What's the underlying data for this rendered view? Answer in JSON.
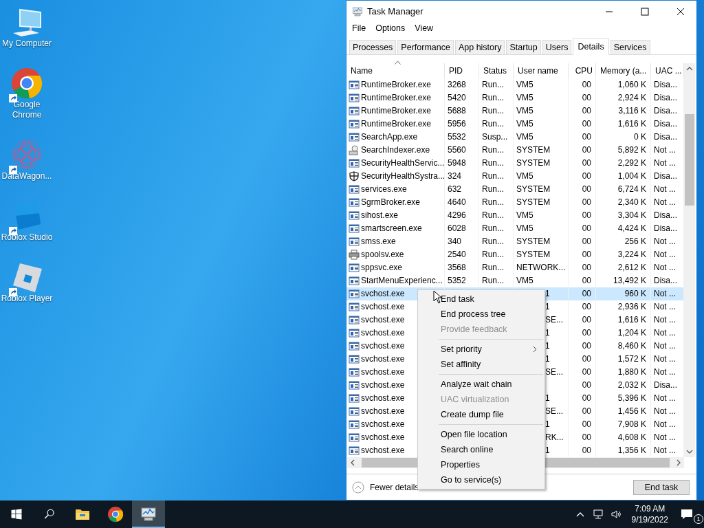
{
  "desktop": {
    "icons": [
      {
        "label": "My Computer",
        "kind": "computer",
        "shortcut": false
      },
      {
        "label": "Google Chrome",
        "kind": "chrome",
        "shortcut": true
      },
      {
        "label": "DataWagon...",
        "kind": "datawagon",
        "shortcut": true
      },
      {
        "label": "Roblox Studio",
        "kind": "studio",
        "shortcut": true
      },
      {
        "label": "Roblox Player",
        "kind": "player",
        "shortcut": true
      }
    ]
  },
  "window": {
    "title": "Task Manager",
    "menu": [
      "File",
      "Options",
      "View"
    ],
    "tabs": [
      {
        "label": "Processes",
        "selected": false
      },
      {
        "label": "Performance",
        "selected": false
      },
      {
        "label": "App history",
        "selected": false
      },
      {
        "label": "Startup",
        "selected": false
      },
      {
        "label": "Users",
        "selected": false
      },
      {
        "label": "Details",
        "selected": true
      },
      {
        "label": "Services",
        "selected": false
      }
    ],
    "table": {
      "columns": [
        "Name",
        "PID",
        "Status",
        "User name",
        "CPU",
        "Memory (a...",
        "UAC ..."
      ],
      "rows": [
        {
          "kind": "app",
          "name": "RuntimeBroker.exe",
          "pid": "3268",
          "status": "Run...",
          "user": "VM5",
          "cpu": "00",
          "memory": "1,060 K",
          "uac": "Disa...",
          "selected": false
        },
        {
          "kind": "app",
          "name": "RuntimeBroker.exe",
          "pid": "5420",
          "status": "Run...",
          "user": "VM5",
          "cpu": "00",
          "memory": "2,924 K",
          "uac": "Disa...",
          "selected": false
        },
        {
          "kind": "app",
          "name": "RuntimeBroker.exe",
          "pid": "5688",
          "status": "Run...",
          "user": "VM5",
          "cpu": "00",
          "memory": "3,116 K",
          "uac": "Disa...",
          "selected": false
        },
        {
          "kind": "app",
          "name": "RuntimeBroker.exe",
          "pid": "5956",
          "status": "Run...",
          "user": "VM5",
          "cpu": "00",
          "memory": "1,616 K",
          "uac": "Disa...",
          "selected": false
        },
        {
          "kind": "app",
          "name": "SearchApp.exe",
          "pid": "5532",
          "status": "Susp...",
          "user": "VM5",
          "cpu": "00",
          "memory": "0 K",
          "uac": "Disa...",
          "selected": false
        },
        {
          "kind": "indexer",
          "name": "SearchIndexer.exe",
          "pid": "5560",
          "status": "Run...",
          "user": "SYSTEM",
          "cpu": "00",
          "memory": "5,892 K",
          "uac": "Not ...",
          "selected": false
        },
        {
          "kind": "app",
          "name": "SecurityHealthServic...",
          "pid": "5948",
          "status": "Run...",
          "user": "SYSTEM",
          "cpu": "00",
          "memory": "2,292 K",
          "uac": "Not ...",
          "selected": false
        },
        {
          "kind": "shield",
          "name": "SecurityHealthSystra...",
          "pid": "324",
          "status": "Run...",
          "user": "VM5",
          "cpu": "00",
          "memory": "1,004 K",
          "uac": "Disa...",
          "selected": false
        },
        {
          "kind": "app",
          "name": "services.exe",
          "pid": "632",
          "status": "Run...",
          "user": "SYSTEM",
          "cpu": "00",
          "memory": "6,724 K",
          "uac": "Not ...",
          "selected": false
        },
        {
          "kind": "app",
          "name": "SgrmBroker.exe",
          "pid": "4640",
          "status": "Run...",
          "user": "SYSTEM",
          "cpu": "00",
          "memory": "2,340 K",
          "uac": "Not ...",
          "selected": false
        },
        {
          "kind": "app",
          "name": "sihost.exe",
          "pid": "4296",
          "status": "Run...",
          "user": "VM5",
          "cpu": "00",
          "memory": "3,304 K",
          "uac": "Disa...",
          "selected": false
        },
        {
          "kind": "app",
          "name": "smartscreen.exe",
          "pid": "6028",
          "status": "Run...",
          "user": "VM5",
          "cpu": "00",
          "memory": "4,424 K",
          "uac": "Disa...",
          "selected": false
        },
        {
          "kind": "app",
          "name": "smss.exe",
          "pid": "340",
          "status": "Run...",
          "user": "SYSTEM",
          "cpu": "00",
          "memory": "256 K",
          "uac": "Not ...",
          "selected": false
        },
        {
          "kind": "printer",
          "name": "spoolsv.exe",
          "pid": "2540",
          "status": "Run...",
          "user": "SYSTEM",
          "cpu": "00",
          "memory": "3,224 K",
          "uac": "Not ...",
          "selected": false
        },
        {
          "kind": "app",
          "name": "sppsvc.exe",
          "pid": "3568",
          "status": "Run...",
          "user": "NETWORK...",
          "cpu": "00",
          "memory": "2,612 K",
          "uac": "Not ...",
          "selected": false
        },
        {
          "kind": "app",
          "name": "StartMenuExperienc...",
          "pid": "5352",
          "status": "Run...",
          "user": "VM5",
          "cpu": "00",
          "memory": "13,492 K",
          "uac": "Disa...",
          "selected": false
        },
        {
          "kind": "app",
          "name": "svchost.exe",
          "user": "1",
          "cpu": "00",
          "memory": "960 K",
          "uac": "Not ...",
          "selected": true
        },
        {
          "kind": "app",
          "name": "svchost.exe",
          "user": "1",
          "cpu": "00",
          "memory": "2,936 K",
          "uac": "Not ...",
          "selected": false
        },
        {
          "kind": "app",
          "name": "svchost.exe",
          "user": "SE...",
          "cpu": "00",
          "memory": "1,616 K",
          "uac": "Not ...",
          "selected": false
        },
        {
          "kind": "app",
          "name": "svchost.exe",
          "user": "1",
          "cpu": "00",
          "memory": "1,204 K",
          "uac": "Not ...",
          "selected": false
        },
        {
          "kind": "app",
          "name": "svchost.exe",
          "user": "1",
          "cpu": "00",
          "memory": "8,460 K",
          "uac": "Not ...",
          "selected": false
        },
        {
          "kind": "app",
          "name": "svchost.exe",
          "user": "1",
          "cpu": "00",
          "memory": "1,572 K",
          "uac": "Not ...",
          "selected": false
        },
        {
          "kind": "app",
          "name": "svchost.exe",
          "user": "SE...",
          "cpu": "00",
          "memory": "1,880 K",
          "uac": "Not ...",
          "selected": false
        },
        {
          "kind": "app",
          "name": "svchost.exe",
          "cpu": "00",
          "memory": "2,032 K",
          "uac": "Disa...",
          "selected": false
        },
        {
          "kind": "app",
          "name": "svchost.exe",
          "user": "1",
          "cpu": "00",
          "memory": "5,396 K",
          "uac": "Not ...",
          "selected": false
        },
        {
          "kind": "app",
          "name": "svchost.exe",
          "user": "SE...",
          "cpu": "00",
          "memory": "1,456 K",
          "uac": "Not ...",
          "selected": false
        },
        {
          "kind": "app",
          "name": "svchost.exe",
          "user": "1",
          "cpu": "00",
          "memory": "7,908 K",
          "uac": "Not ...",
          "selected": false
        },
        {
          "kind": "app",
          "name": "svchost.exe",
          "user": "RK...",
          "cpu": "00",
          "memory": "4,608 K",
          "uac": "Not ...",
          "selected": false
        },
        {
          "kind": "app",
          "name": "svchost.exe",
          "user": "1",
          "cpu": "00",
          "memory": "1,356 K",
          "uac": "Not ...",
          "selected": false
        }
      ]
    },
    "footer": {
      "toggle": "Fewer details",
      "button": "End task"
    },
    "context_menu": {
      "groups": [
        [
          {
            "label": "End task",
            "disabled": false,
            "submenu": false
          },
          {
            "label": "End process tree",
            "disabled": false,
            "submenu": false
          },
          {
            "label": "Provide feedback",
            "disabled": true,
            "submenu": false
          }
        ],
        [
          {
            "label": "Set priority",
            "disabled": false,
            "submenu": true
          },
          {
            "label": "Set affinity",
            "disabled": false,
            "submenu": false
          }
        ],
        [
          {
            "label": "Analyze wait chain",
            "disabled": false,
            "submenu": false
          },
          {
            "label": "UAC virtualization",
            "disabled": true,
            "submenu": false
          },
          {
            "label": "Create dump file",
            "disabled": false,
            "submenu": false
          }
        ],
        [
          {
            "label": "Open file location",
            "disabled": false,
            "submenu": false
          },
          {
            "label": "Search online",
            "disabled": false,
            "submenu": false
          },
          {
            "label": "Properties",
            "disabled": false,
            "submenu": false
          },
          {
            "label": "Go to service(s)",
            "disabled": false,
            "submenu": false
          }
        ]
      ]
    }
  },
  "taskbar": {
    "apps": [
      {
        "kind": "explorer",
        "selected": false
      },
      {
        "kind": "chrome",
        "selected": false
      },
      {
        "kind": "taskmgr",
        "selected": true
      }
    ],
    "time": "7:09 AM",
    "date": "9/19/2022",
    "notifications": "1"
  }
}
